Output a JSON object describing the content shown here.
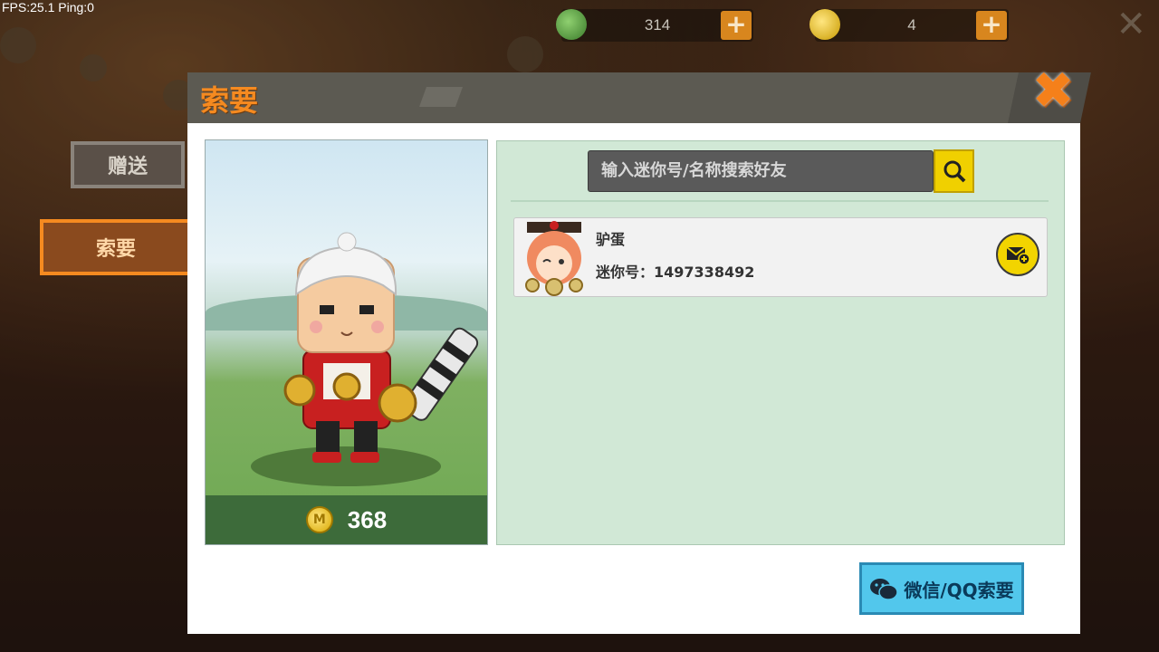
{
  "hud": {
    "fps_text": "FPS:25.1  Ping:0"
  },
  "currency": [
    {
      "icon": "green-bean-coin-icon",
      "value": "314",
      "plus": "+"
    },
    {
      "icon": "gold-mini-coin-icon",
      "value": "4",
      "plus": "+"
    }
  ],
  "tabs": [
    {
      "label": "赠送",
      "active": false
    },
    {
      "label": "索要",
      "active": true
    }
  ],
  "modal": {
    "title": "索要",
    "close_icon": "close-x-icon"
  },
  "character": {
    "price": "368",
    "price_icon": "gold-mini-coin-icon"
  },
  "search": {
    "placeholder": "输入迷你号/名称搜索好友",
    "icon": "search-icon"
  },
  "friends": [
    {
      "name": "驴蛋",
      "id_label": "迷你号：",
      "id": "1497338492",
      "action_icon": "send-mail-icon"
    }
  ],
  "share_button": {
    "label": "微信/QQ索要",
    "icon": "wechat-icon"
  },
  "colors": {
    "accent_orange": "#f58a20",
    "panel_green": "#d1e8d6",
    "button_blue": "#52c7ec",
    "search_yellow": "#f0d000"
  }
}
